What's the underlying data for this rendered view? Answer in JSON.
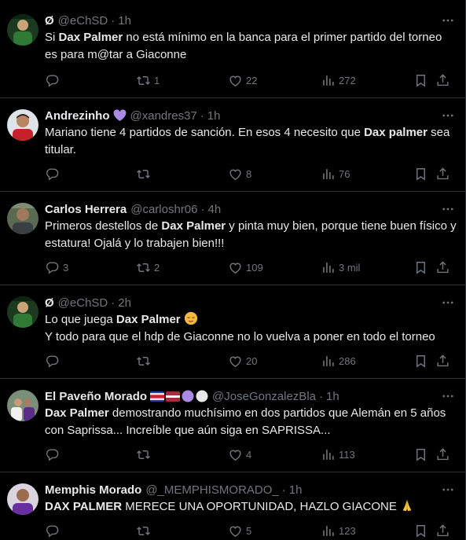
{
  "colors": {
    "background": "#000000",
    "text": "#e7e9ea",
    "muted": "#71767b",
    "border": "#2f3336",
    "heart_purple": "#a98be6"
  },
  "tweets": [
    {
      "name": "Ø",
      "handle": "@eChSD",
      "time": "1h",
      "avatar": "green-team-avatar",
      "text_1": "Si ",
      "text_bold_1": "Dax Palmer",
      "text_2": " no está mínimo en la banca para el primer partido del torneo es para m@tar a Giaconne",
      "replies": "",
      "reposts": "1",
      "likes": "22",
      "views": "272"
    },
    {
      "name": "Andrezinho",
      "handle": "@xandres37",
      "time": "1h",
      "avatar": "player-photo-avatar",
      "name_badge": "purple-heart-emoji",
      "text_1": "Mariano tiene 4 partidos de sanción. En esos 4 necesito que ",
      "text_bold_1": "Dax palmer",
      "text_2": " sea titular.",
      "replies": "",
      "reposts": "",
      "likes": "8",
      "views": "76"
    },
    {
      "name": "Carlos Herrera",
      "handle": "@carloshr06",
      "time": "4h",
      "avatar": "portrait-avatar",
      "text_1": "Primeros destellos de ",
      "text_bold_1": "Dax Palmer",
      "text_2": " y pinta muy bien, porque tiene buen físico y estatura! Ojalá y lo trabajen bien!!!",
      "replies": "3",
      "reposts": "2",
      "likes": "109",
      "views": "3 mil"
    },
    {
      "name": "Ø",
      "handle": "@eChSD",
      "time": "2h",
      "avatar": "green-team-avatar",
      "text_1": "Lo que juega ",
      "text_bold_1": "Dax Palmer",
      "text_emoji": "relieved-face-emoji",
      "text_2": "Y todo para que el hdp de Giaconne no lo vuelva a poner en todo el torneo",
      "replies": "",
      "reposts": "",
      "likes": "20",
      "views": "286"
    },
    {
      "name": "El Paveño Morado",
      "handle": "@JoseGonzalezBla",
      "time": "1h",
      "avatar": "team-photo-avatar",
      "name_badge": "costa-rica-flag, latvia-flag, purple-circle, white-circle",
      "text_bold_1": "Dax Palmer",
      "text_2": " demostrando muchísimo en dos partidos que Alemán en 5 años con Saprissa... Increíble que aún siga en SAPRISSA...",
      "replies": "",
      "reposts": "",
      "likes": "4",
      "views": "113"
    },
    {
      "name": "Memphis Morado",
      "handle": "@_MEMPHISMORADO_",
      "time": "1h",
      "avatar": "purple-jersey-avatar",
      "text_bold_1": "DAX PALMER",
      "text_2": " MERECE UNA OPORTUNIDAD, HAZLO GIACONE ",
      "text_emoji": "folded-hands-emoji",
      "replies": "",
      "reposts": "",
      "likes": "5",
      "views": "123"
    }
  ],
  "icons": {
    "reply": "reply-icon",
    "repost": "repost-icon",
    "like": "heart-icon",
    "views": "views-chart-icon",
    "bookmark": "bookmark-icon",
    "share": "share-icon",
    "more": "more-dots-icon"
  }
}
